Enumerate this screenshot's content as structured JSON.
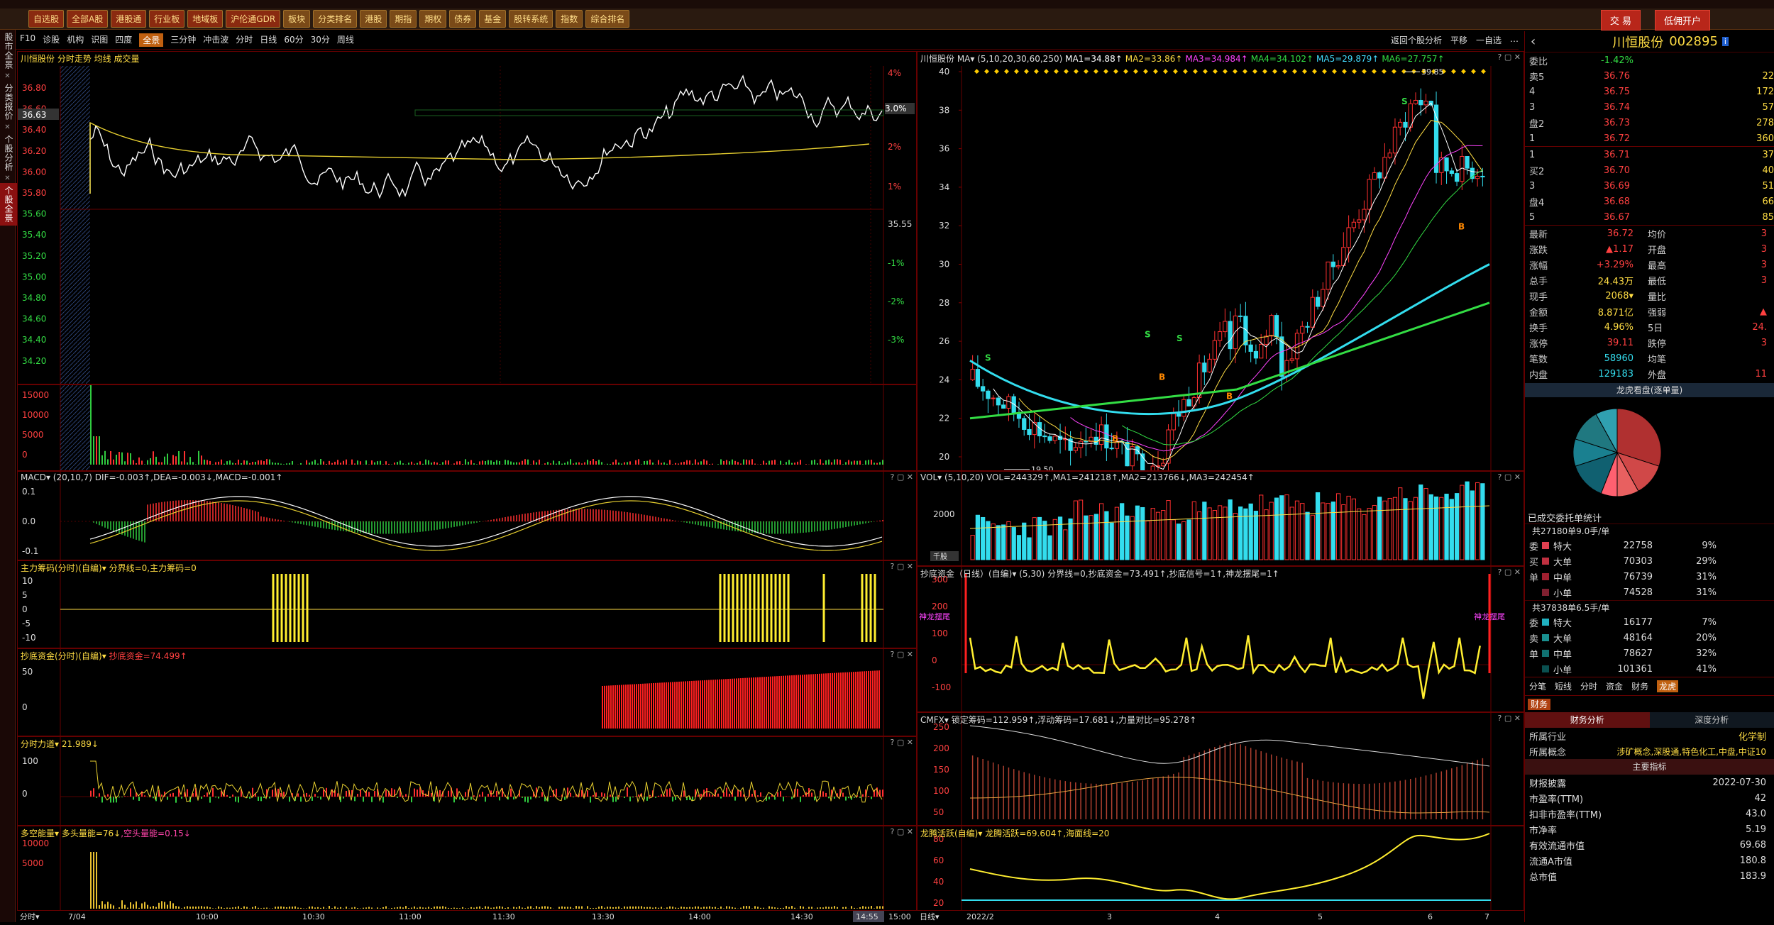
{
  "toolbar": {
    "items": [
      "自选股",
      "全部A股",
      "港股通",
      "行业板",
      "地域板",
      "沪伦通GDR",
      "板块",
      "分类排名",
      "港股",
      "期指",
      "期权",
      "债券",
      "基金",
      "股转系统",
      "指数",
      "综合排名"
    ],
    "trade": "交 易",
    "open_account": "低佣开户"
  },
  "leftnav": {
    "tabs": [
      "股市全景",
      "分类报价",
      "个股分析",
      "个股全景"
    ]
  },
  "subbar": {
    "items": [
      "F10",
      "诊股",
      "机构",
      "识图",
      "四度",
      "全景",
      "三分钟",
      "冲击波",
      "分时",
      "日线",
      "60分",
      "30分",
      "周线"
    ],
    "active": "全景",
    "right": [
      "返回个股分析",
      "平移",
      "一自选",
      "…"
    ]
  },
  "intraday": {
    "title": "川恒股份 分时走势 均线 成交量",
    "price_labels": [
      "36.80",
      "36.60",
      "36.40",
      "36.20",
      "36.00",
      "35.80",
      "35.60",
      "35.40",
      "35.20",
      "35.00",
      "34.80",
      "34.60",
      "34.40",
      "34.20"
    ],
    "current": "36.63",
    "pct_labels": [
      "4%",
      "3.0%",
      "2%",
      "1%",
      "35.55",
      "-1%",
      "-2%",
      "-3%"
    ],
    "vol_labels": [
      "15000",
      "10000",
      "5000",
      "0"
    ],
    "time_labels": [
      "7/04",
      "10:00",
      "10:30",
      "11:00",
      "11:30",
      "13:30",
      "14:00",
      "14:30",
      "14:55",
      "15:00"
    ],
    "time_label": "分时"
  },
  "panes": {
    "macd": {
      "title": "MACD▾ (20,10,7) DIF=-0.003↑,DEA=-0.003↓,MACD=-0.001↑",
      "labels": [
        "0.1",
        "0.0",
        "-0.1"
      ]
    },
    "main_chip": {
      "title": "主力筹码(分时)(自编)▾ 分界线=0,主力筹码=0",
      "labels": [
        "10",
        "5",
        "0",
        "-5",
        "-10"
      ]
    },
    "bottom_fund": {
      "title": "抄底资金(分时)(自编)▾ ",
      "title2": "抄底资金=74.499↑",
      "labels": [
        "50",
        "0"
      ]
    },
    "force": {
      "title": "分时力道▾ ",
      "title2": "21.989↓",
      "labels": [
        "100",
        "0"
      ]
    },
    "multi": {
      "title": "多空能量▾ 多头量能=76↓",
      "title2": ",空头量能=0.15↓",
      "labels": [
        "10000",
        "5000"
      ]
    }
  },
  "kline": {
    "title": "川恒股份 MA▾ (5,10,20,30,60,250) ",
    "ma": [
      "MA1=34.88↑",
      "MA2=33.86↑",
      "MA3=34.984↑",
      "MA4=34.102↑",
      "MA5=29.879↑",
      "MA6=27.757↑"
    ],
    "price_labels": [
      "40",
      "38",
      "36",
      "34",
      "32",
      "30",
      "28",
      "26",
      "24",
      "22",
      "20"
    ],
    "high": "39.85",
    "low": "19.50",
    "x_labels": [
      "2022/2",
      "3",
      "4",
      "5",
      "6",
      "7"
    ],
    "x_label": "日线"
  },
  "kpanes": {
    "vol": {
      "title": "VOL▾ (5,10,20) VOL=244329↑,MA1=241218↑,MA2=213766↓,MA3=242454↑",
      "labels": [
        "2000",
        "千股"
      ]
    },
    "bottom": {
      "title": "抄底资金（日线）(自编)▾ (5,30) 分界线=0,抄底资金=73.491↑,抄底信号=1↑,神龙摆尾=1↑",
      "labels": [
        "300",
        "200",
        "100",
        "0",
        "-100"
      ],
      "tag": "神龙摆尾"
    },
    "cmfx": {
      "title": "CMFX▾ 锁定筹码=112.959↑,浮动筹码=17.681↓,力量对比=95.278↑",
      "labels": [
        "250",
        "200",
        "150",
        "100",
        "50"
      ]
    },
    "dragon": {
      "title": "龙腾活跃(自编)▾ 龙腾活跃=69.604↑,海面线=20",
      "labels": [
        "80",
        "60",
        "40",
        "20"
      ]
    }
  },
  "quote": {
    "name": "川恒股份",
    "code": "002895",
    "wb_label": "委比",
    "wb": "-1.42%",
    "sell": [
      {
        "l": "卖5",
        "p": "36.76",
        "v": "22"
      },
      {
        "l": "4",
        "p": "36.75",
        "v": "172"
      },
      {
        "l": "3",
        "p": "36.74",
        "v": "57"
      },
      {
        "l": "盘2",
        "p": "36.73",
        "v": "278"
      },
      {
        "l": "1",
        "p": "36.72",
        "v": "360"
      }
    ],
    "buy": [
      {
        "l": "1",
        "p": "36.71",
        "v": "37"
      },
      {
        "l": "买2",
        "p": "36.70",
        "v": "40"
      },
      {
        "l": "3",
        "p": "36.69",
        "v": "51"
      },
      {
        "l": "盘4",
        "p": "36.68",
        "v": "66"
      },
      {
        "l": "5",
        "p": "36.67",
        "v": "85"
      }
    ],
    "stats": [
      {
        "a": "最新",
        "b": "36.72",
        "c": "均价",
        "d": "3"
      },
      {
        "a": "涨跌",
        "b": "▲1.17",
        "c": "开盘",
        "d": "3"
      },
      {
        "a": "涨幅",
        "b": "+3.29%",
        "c": "最高",
        "d": "3"
      },
      {
        "a": "总手",
        "b": "24.43万",
        "c": "最低",
        "d": "3"
      },
      {
        "a": "现手",
        "b": "2068▾",
        "c": "量比",
        "d": ""
      },
      {
        "a": "金额",
        "b": "8.871亿",
        "c": "强弱",
        "d": "▲"
      },
      {
        "a": "换手",
        "b": "4.96%",
        "c": "5日",
        "d": "24."
      },
      {
        "a": "涨停",
        "b": "39.11",
        "c": "跌停",
        "d": "3"
      },
      {
        "a": "笔数",
        "b": "58960",
        "c": "均笔",
        "d": ""
      },
      {
        "a": "内盘",
        "b": "129183",
        "c": "外盘",
        "d": "11"
      }
    ],
    "dragon_title": "龙虎看盘(逐单量)",
    "pie": [
      {
        "v": 30,
        "c": "#b03030"
      },
      {
        "v": 12,
        "c": "#d04848"
      },
      {
        "v": 8,
        "c": "#e86060"
      },
      {
        "v": 6,
        "c": "#ff6070"
      },
      {
        "v": 14,
        "c": "#106070"
      },
      {
        "v": 10,
        "c": "#1a8090"
      },
      {
        "v": 12,
        "c": "#207880"
      },
      {
        "v": 8,
        "c": "#30a0b0"
      }
    ],
    "entrust_title": "已成交委托单统计",
    "buy_total": "共27180单9.0手/单",
    "buy_rows": [
      {
        "s": "委",
        "t": "特大",
        "v": "22758",
        "p": "9%",
        "c": "#e04050"
      },
      {
        "s": "买",
        "t": "大单",
        "v": "70303",
        "p": "29%",
        "c": "#c03040"
      },
      {
        "s": "单",
        "t": "中单",
        "v": "76739",
        "p": "31%",
        "c": "#a02030"
      },
      {
        "s": "",
        "t": "小单",
        "v": "74528",
        "p": "31%",
        "c": "#802030"
      }
    ],
    "sell_total": "共37838单6.5手/单",
    "sell_rows": [
      {
        "s": "委",
        "t": "特大",
        "v": "16177",
        "p": "7%",
        "c": "#20b0c0"
      },
      {
        "s": "卖",
        "t": "大单",
        "v": "48164",
        "p": "20%",
        "c": "#1a9090"
      },
      {
        "s": "单",
        "t": "中单",
        "v": "78627",
        "p": "32%",
        "c": "#107070"
      },
      {
        "s": "",
        "t": "小单",
        "v": "101361",
        "p": "41%",
        "c": "#0a5050"
      }
    ],
    "tabs": [
      "分笔",
      "短线",
      "分时",
      "资金",
      "财务",
      "龙虎"
    ],
    "tab_active": "龙虎",
    "fin_tab": "财务",
    "fin_tabs": [
      "财务分析",
      "深度分析"
    ],
    "industry_l": "所属行业",
    "industry": "化学制",
    "concept_l": "所属概念",
    "concept": "涉矿概念,深股通,特色化工,中盘,中证10",
    "main_title": "主要指标",
    "fin": [
      {
        "a": "财报披露",
        "b": "2022-07-30"
      },
      {
        "a": "市盈率(TTM)",
        "b": "42"
      },
      {
        "a": "扣非市盈率(TTM)",
        "b": "43.0"
      },
      {
        "a": "市净率",
        "b": "5.19"
      },
      {
        "a": "有效流通市值",
        "b": "69.68"
      },
      {
        "a": "流通A市值",
        "b": "180.8"
      },
      {
        "a": "总市值",
        "b": "183.9"
      }
    ]
  }
}
